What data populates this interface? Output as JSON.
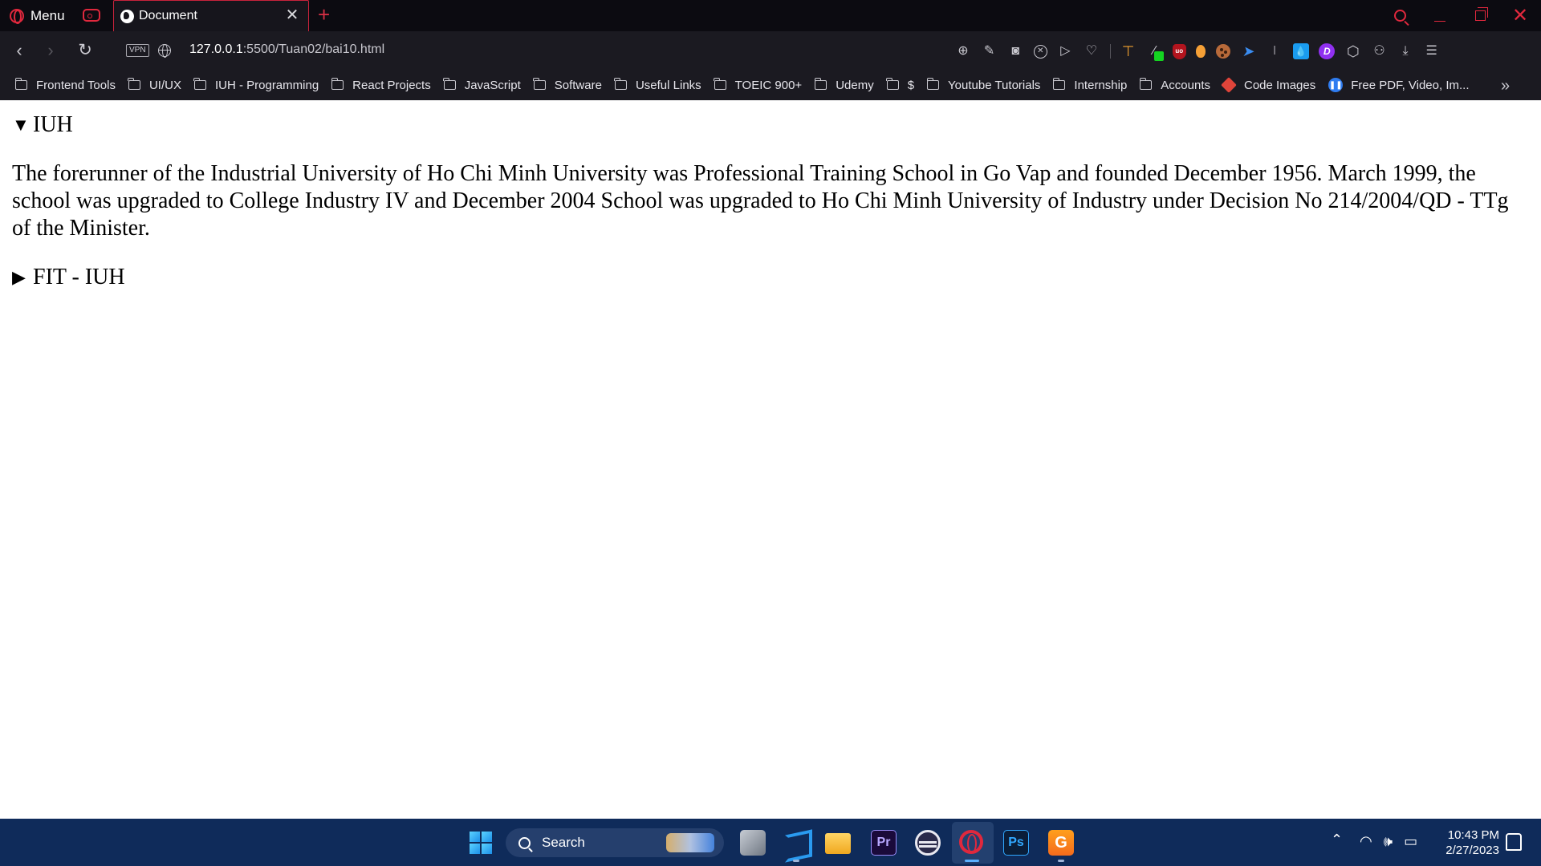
{
  "browser": {
    "menu_label": "Menu",
    "tab_title": "Document",
    "close_tab_glyph": "✕",
    "new_tab_glyph": "+",
    "accent_color": "#e0283d",
    "vpn_label": "VPN",
    "url_host": "127.0.0.1",
    "url_path": ":5500/Tuan02/bai10.html",
    "window_close_glyph": "✕"
  },
  "bookmarks": [
    {
      "label": "Frontend Tools",
      "icon": "folder-icon"
    },
    {
      "label": "UI/UX",
      "icon": "folder-icon"
    },
    {
      "label": "IUH - Programming",
      "icon": "folder-icon"
    },
    {
      "label": "React Projects",
      "icon": "folder-icon"
    },
    {
      "label": "JavaScript",
      "icon": "folder-icon"
    },
    {
      "label": "Software",
      "icon": "folder-icon"
    },
    {
      "label": "Useful Links",
      "icon": "folder-icon"
    },
    {
      "label": "TOEIC 900+",
      "icon": "folder-icon"
    },
    {
      "label": "Udemy",
      "icon": "folder-icon"
    },
    {
      "label": "$",
      "icon": "folder-icon"
    },
    {
      "label": "Youtube Tutorials",
      "icon": "folder-icon"
    },
    {
      "label": "Internship",
      "icon": "folder-icon"
    },
    {
      "label": "Accounts",
      "icon": "folder-icon"
    },
    {
      "label": "Code Images",
      "icon": "code-images-icon"
    },
    {
      "label": "Free PDF, Video, Im...",
      "icon": "pdf-tools-icon"
    }
  ],
  "page": {
    "details_1": {
      "summary": "IUH",
      "open": true,
      "content": "The forerunner of the Industrial University of Ho Chi Minh University was Professional Training School in Go Vap and founded December 1956. March 1999, the school was upgraded to College Industry IV and December 2004 School was upgraded to Ho Chi Minh University of Industry under Decision No 214/2004/QD - TTg of the Minister."
    },
    "details_2": {
      "summary": "FIT - IUH",
      "open": false
    }
  },
  "taskbar": {
    "search_label": "Search",
    "time": "10:43 PM",
    "date": "2/27/2023",
    "color": "#0f2b5a"
  }
}
